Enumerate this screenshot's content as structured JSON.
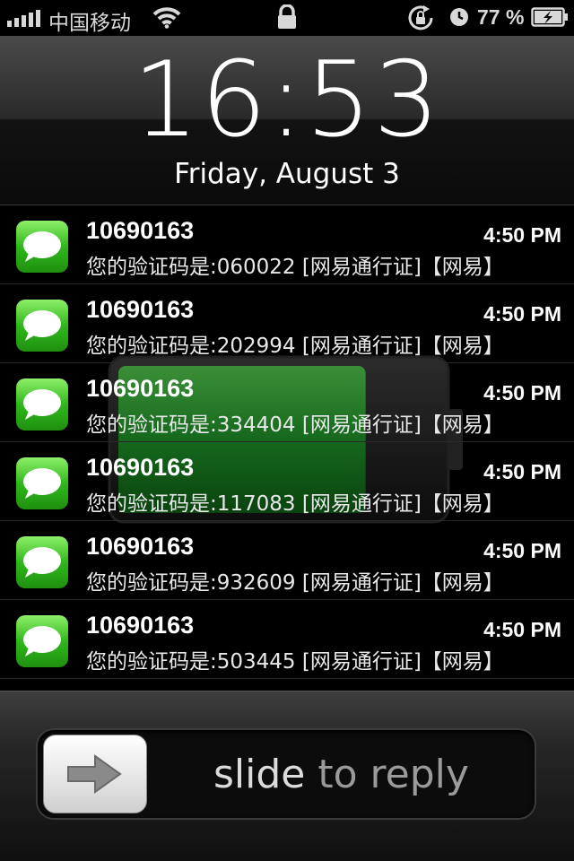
{
  "status_bar": {
    "carrier": "中国移动",
    "battery_percent": "77 %",
    "signal_strength": 5,
    "icons": [
      "signal-icon",
      "wifi-icon",
      "lock-icon",
      "rotation-lock-icon",
      "alarm-icon",
      "battery-charging-icon"
    ]
  },
  "lock_screen": {
    "time": "16:53",
    "date": "Friday, August 3",
    "charging_level": 0.77
  },
  "notifications": [
    {
      "sender": "10690163",
      "time": "4:50 PM",
      "body": "您的验证码是:060022 [网易通行证]【网易】"
    },
    {
      "sender": "10690163",
      "time": "4:50 PM",
      "body": "您的验证码是:202994 [网易通行证]【网易】"
    },
    {
      "sender": "10690163",
      "time": "4:50 PM",
      "body": "您的验证码是:334404 [网易通行证]【网易】"
    },
    {
      "sender": "10690163",
      "time": "4:50 PM",
      "body": "您的验证码是:117083 [网易通行证]【网易】"
    },
    {
      "sender": "10690163",
      "time": "4:50 PM",
      "body": "您的验证码是:932609 [网易通行证]【网易】"
    },
    {
      "sender": "10690163",
      "time": "4:50 PM",
      "body": "您的验证码是:503445 [网易通行证]【网易】"
    }
  ],
  "slider": {
    "action_word": "slide",
    "action_rest": " to reply"
  },
  "colors": {
    "message_icon_green": "#2fb81a",
    "battery_green": "#1f8a2a"
  }
}
